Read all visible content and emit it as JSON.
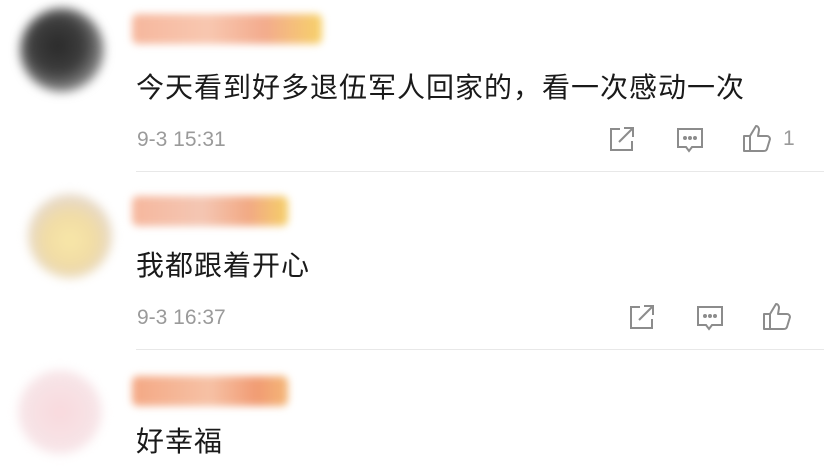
{
  "comments": [
    {
      "text": "今天看到好多退伍军人回家的，看一次感动一次",
      "time": "9-3 15:31",
      "likes": "1",
      "avatar_icon": "blurred-avatar",
      "username_icon": "blurred-username"
    },
    {
      "text": "我都跟着开心",
      "time": "9-3 16:37",
      "likes": "",
      "avatar_icon": "blurred-avatar",
      "username_icon": "blurred-username"
    },
    {
      "text": "好幸福",
      "time": "",
      "likes": "",
      "avatar_icon": "blurred-avatar",
      "username_icon": "blurred-username"
    }
  ],
  "icons": {
    "share": "share-icon",
    "reply": "comment-icon",
    "like": "thumbs-up-icon"
  },
  "colors": {
    "text": "#1a1a1a",
    "meta": "#9a9a9a",
    "icon": "#8c8c8c",
    "divider": "#e8e8e8"
  }
}
